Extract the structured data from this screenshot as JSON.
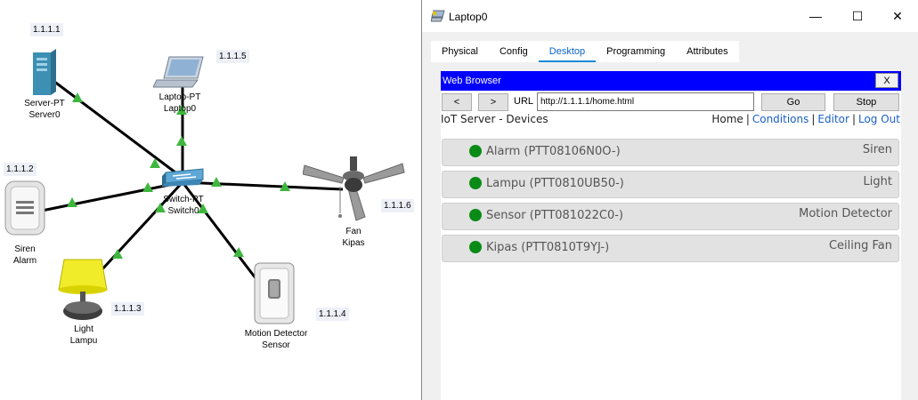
{
  "topology": {
    "server": {
      "type": "Server-PT",
      "name": "Server0",
      "ip": "1.1.1.1"
    },
    "laptop": {
      "type": "Laptop-PT",
      "name": "Laptop0",
      "ip": "1.1.1.5"
    },
    "switch": {
      "type": "Switch-PT",
      "name": "Switch0"
    },
    "siren": {
      "type": "Siren",
      "name": "Alarm",
      "ip": "1.1.1.2"
    },
    "light": {
      "type": "Light",
      "name": "Lampu",
      "ip": "1.1.1.3"
    },
    "motion": {
      "type": "Motion Detector",
      "name": "Sensor",
      "ip": "1.1.1.4"
    },
    "fan": {
      "type": "Fan",
      "name": "Kipas",
      "ip": "1.1.1.6"
    }
  },
  "window": {
    "title": "Laptop0",
    "controls": {
      "minimize": "—",
      "maximize": "☐",
      "close": "✕"
    },
    "tabs": [
      {
        "label": "Physical",
        "active": false
      },
      {
        "label": "Config",
        "active": false
      },
      {
        "label": "Desktop",
        "active": true
      },
      {
        "label": "Programming",
        "active": false
      },
      {
        "label": "Attributes",
        "active": false
      }
    ]
  },
  "browser": {
    "title": "Web Browser",
    "close_label": "X",
    "back_label": "<",
    "forward_label": ">",
    "url_label": "URL",
    "url": "http://1.1.1.1/home.html",
    "go_label": "Go",
    "stop_label": "Stop",
    "heading": "IoT Server - Devices",
    "nav": {
      "home": "Home",
      "sep": "|",
      "conditions": "Conditions",
      "editor": "Editor",
      "logout": "Log Out"
    },
    "devices": [
      {
        "name": "Alarm (PTT08106N0O-)",
        "type": "Siren",
        "status_color": "#0a8a16"
      },
      {
        "name": "Lampu (PTT0810UB50-)",
        "type": "Light",
        "status_color": "#0a8a16"
      },
      {
        "name": "Sensor (PTT081022C0-)",
        "type": "Motion Detector",
        "status_color": "#0a8a16"
      },
      {
        "name": "Kipas (PTT0810T9YJ-)",
        "type": "Ceiling Fan",
        "status_color": "#0a8a16"
      }
    ]
  }
}
